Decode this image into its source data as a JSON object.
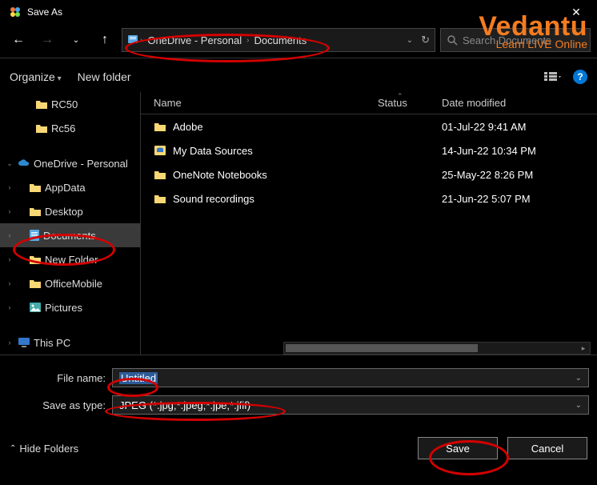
{
  "window": {
    "title": "Save As"
  },
  "breadcrumb": {
    "seg1": "OneDrive - Personal",
    "seg2": "Documents"
  },
  "search": {
    "placeholder": "Search Documents"
  },
  "toolbar": {
    "organize": "Organize",
    "newfolder": "New folder"
  },
  "columns": {
    "name": "Name",
    "status": "Status",
    "date": "Date modified"
  },
  "tree": {
    "rc50": "RC50",
    "rc56": "Rc56",
    "onedrive": "OneDrive - Personal",
    "appdata": "AppData",
    "desktop": "Desktop",
    "documents": "Documents",
    "newfolder": "New Folder",
    "officemobile": "OfficeMobile",
    "pictures": "Pictures",
    "thispc": "This PC"
  },
  "files": [
    {
      "name": "Adobe",
      "date": "01-Jul-22 9:41 AM"
    },
    {
      "name": "My Data Sources",
      "date": "14-Jun-22 10:34 PM"
    },
    {
      "name": "OneNote Notebooks",
      "date": "25-May-22 8:26 PM"
    },
    {
      "name": "Sound recordings",
      "date": "21-Jun-22 5:07 PM"
    }
  ],
  "form": {
    "filename_label": "File name:",
    "filename_value": "Untitled",
    "filetype_label": "Save as type:",
    "filetype_value": "JPEG (*.jpg;*.jpeg;*.jpe;*.jfif)"
  },
  "buttons": {
    "save": "Save",
    "cancel": "Cancel",
    "hide": "Hide Folders"
  },
  "watermark": {
    "brand": "Vedantu",
    "tagline": "Learn LIVE Online"
  }
}
